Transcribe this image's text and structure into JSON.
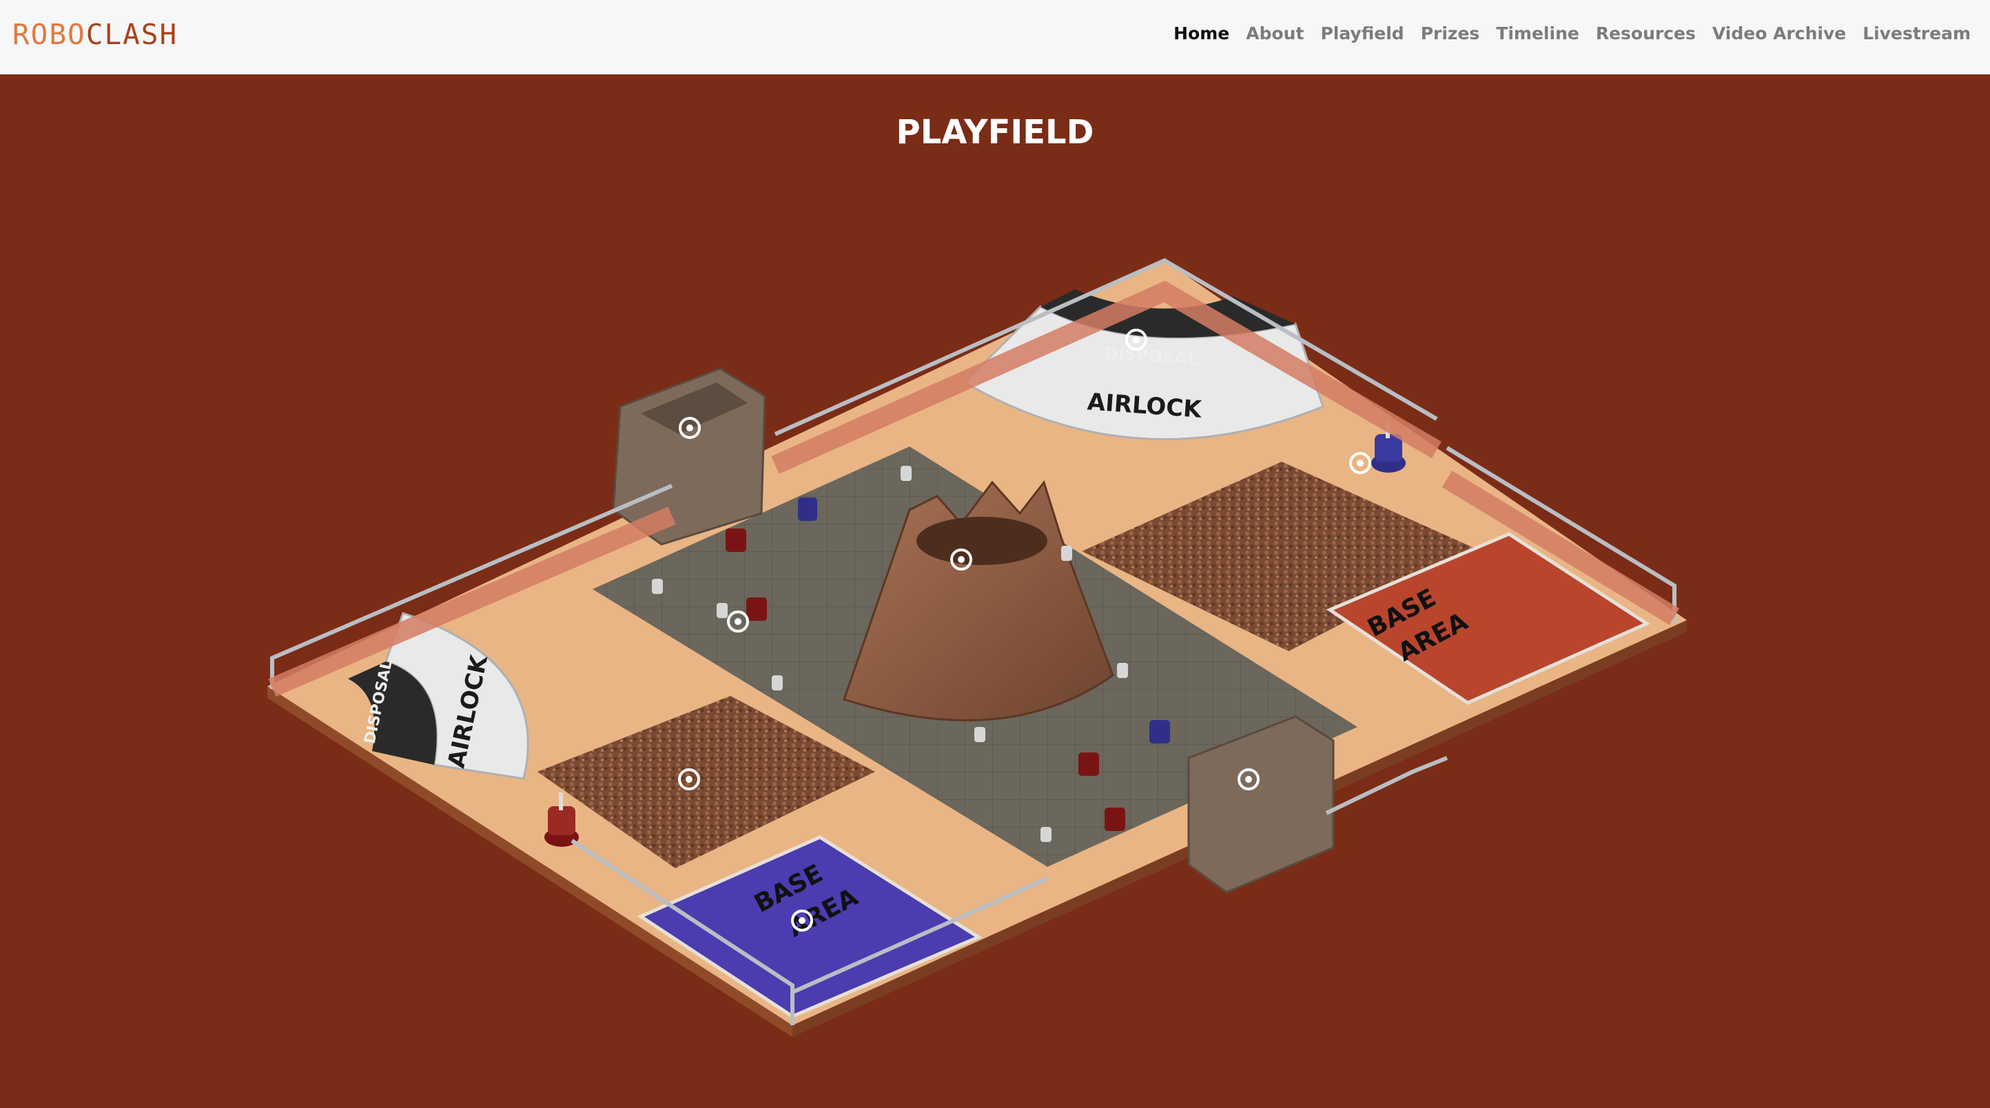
{
  "nav": {
    "logo_part1": "ROBO",
    "logo_part2": "CLASH",
    "links": [
      {
        "label": "Home",
        "active": true
      },
      {
        "label": "About"
      },
      {
        "label": "Playfield"
      },
      {
        "label": "Prizes"
      },
      {
        "label": "Timeline"
      },
      {
        "label": "Resources"
      },
      {
        "label": "Video Archive"
      },
      {
        "label": "Livestream"
      }
    ]
  },
  "page": {
    "title": "PLAYFIELD"
  },
  "playfield": {
    "labels": {
      "disposal_top": "DISPOSAL",
      "airlock_top": "AIRLOCK",
      "disposal_left": "DISPOSAL",
      "airlock_left": "AIRLOCK",
      "base_red_1": "BASE",
      "base_red_2": "AREA",
      "base_blue_1": "BASE",
      "base_blue_2": "AREA"
    },
    "colors": {
      "background": "#7b2c16",
      "sand": "#e9b585",
      "center_floor": "#6a665b",
      "base_red": "#b9452d",
      "base_blue": "#4b3cb0",
      "volcano": "#8a5a3e"
    }
  }
}
